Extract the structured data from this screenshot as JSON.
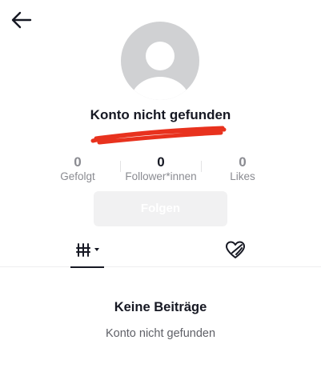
{
  "header": {
    "back_icon": "arrow-left-icon"
  },
  "profile": {
    "username": "Konto nicht gefunden",
    "avatar_icon": "default-avatar-icon",
    "redaction_color": "#e8321e"
  },
  "stats": [
    {
      "value": "0",
      "label": "Gefolgt"
    },
    {
      "value": "0",
      "label": "Follower*innen"
    },
    {
      "value": "0",
      "label": "Likes"
    }
  ],
  "follow_button": {
    "label": "Folgen"
  },
  "tabs": [
    {
      "name": "videos",
      "icon": "grid-icon",
      "has_dropdown": true,
      "active": true
    },
    {
      "name": "liked",
      "icon": "heart-hidden-icon",
      "active": false
    }
  ],
  "empty_state": {
    "title": "Keine Beiträge",
    "subtitle": "Konto nicht gefunden"
  }
}
